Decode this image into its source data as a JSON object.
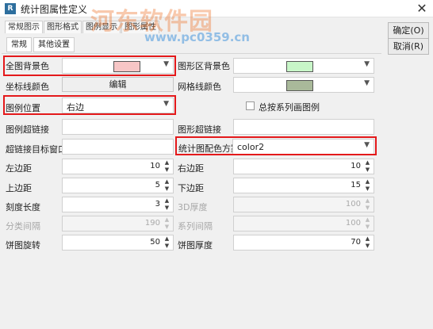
{
  "window": {
    "title": "统计图属性定义",
    "app_icon": "R",
    "close_glyph": "✕"
  },
  "watermark": {
    "text": "河东软件园",
    "url": "www.pc0359.cn"
  },
  "tabs": [
    "常规图示",
    "图形格式",
    "图例显示",
    "图形属性"
  ],
  "subtabs": [
    "常规",
    "其他设置"
  ],
  "buttons": {
    "ok": "确定(O)",
    "cancel": "取消(R)"
  },
  "fields": {
    "bg_color": {
      "label": "全图背景色",
      "color": "#f7c6c6"
    },
    "graph_bg_color": {
      "label": "图形区背景色",
      "color": "#c8f6c8"
    },
    "axis_color": {
      "label": "坐标线颜色",
      "button": "编辑"
    },
    "grid_color": {
      "label": "网格线颜色",
      "color": "#a9b99a"
    },
    "legend_pos": {
      "label": "图例位置",
      "value": "右边"
    },
    "series_legend": {
      "label": "总按系列画图例",
      "checked": false
    },
    "legend_link": {
      "label": "图例超链接"
    },
    "graph_link": {
      "label": "图形超链接"
    },
    "link_target": {
      "label": "超链接目标窗口"
    },
    "color_scheme": {
      "label": "统计图配色方案",
      "value": "color2"
    },
    "left_margin": {
      "label": "左边距",
      "value": "10"
    },
    "right_margin": {
      "label": "右边距",
      "value": "10"
    },
    "top_margin": {
      "label": "上边距",
      "value": "5"
    },
    "bottom_margin": {
      "label": "下边距",
      "value": "15"
    },
    "tick_length": {
      "label": "刻度长度",
      "value": "3"
    },
    "depth_3d": {
      "label": "3D厚度",
      "value": "100"
    },
    "category_gap": {
      "label": "分类间隔",
      "value": "190"
    },
    "series_gap": {
      "label": "系列间隔",
      "value": "100"
    },
    "pie_rotation": {
      "label": "饼图旋转",
      "value": "50"
    },
    "pie_thickness": {
      "label": "饼图厚度",
      "value": "70"
    }
  }
}
